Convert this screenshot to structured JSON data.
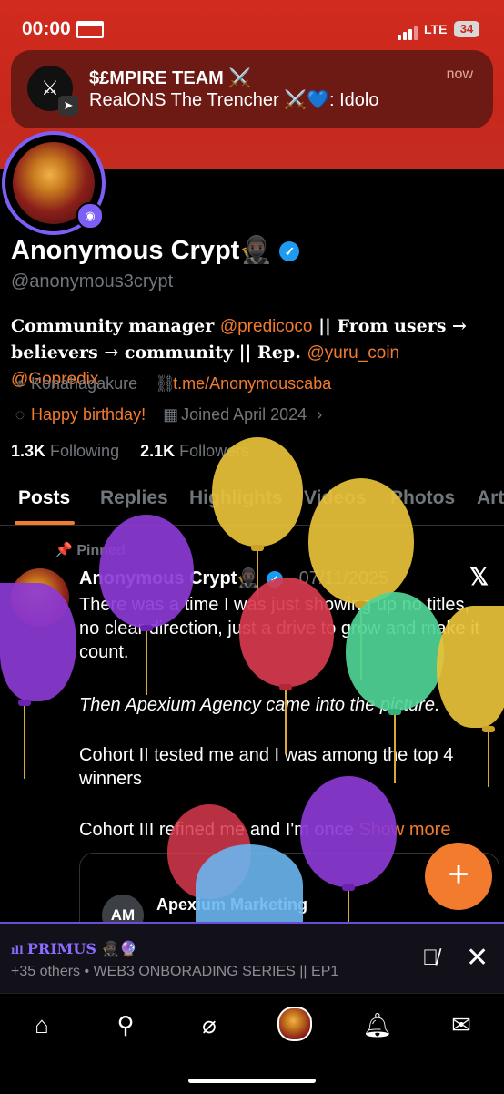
{
  "status": {
    "time": "00:00",
    "network": "LTE",
    "battery": "34"
  },
  "notification": {
    "title": "$£MPIRE TEAM ⚔️",
    "body": "RealONS The Trencher ⚔️💙: Idolo",
    "time": "now",
    "app_icon": "telegram-icon"
  },
  "profile": {
    "name": "Anonymous Crypt🥷🏿",
    "handle": "@anonymous3crypt",
    "bio_parts": {
      "p1": "Community manager ",
      "l1": "@predicoco",
      "p2": " || From users → believers → community || Rep. ",
      "l2": "@yuru_coin",
      "p3": " ",
      "l3": "@Gopredix"
    },
    "location": "Konahagakure",
    "link": "t.me/Anonymouscaba",
    "birthday": "Happy birthday!",
    "joined": "Joined April 2024",
    "following_count": "1.3K",
    "following_label": "Following",
    "followers_count": "2.1K",
    "followers_label": "Followers"
  },
  "tabs": [
    "Posts",
    "Replies",
    "Highlights",
    "Videos",
    "Photos",
    "Art"
  ],
  "post": {
    "pinned_label": "Pinned",
    "author": "Anonymous Crypt🥷🏿",
    "date": "· 07/11/2025",
    "p1": "There was a time I was just showing up no titles, no clear direction, just a drive to grow and make it count.",
    "p2": "Then Apexium Agency came into the picture.",
    "p3": "Cohort II tested me and I was among the top 4 winners",
    "p4": "Cohort III refined me and I'm once ",
    "show_more": "Show more",
    "quote_avatar": "AM",
    "quote_name": "Apexium Marketing"
  },
  "space": {
    "title": "PRIMUS 🥷🏿🔮",
    "subtitle": "+35 others • WEB3 ONBORADING SERIES || EP1"
  },
  "colors": {
    "accent": "#f27b2d",
    "verified": "#1d9bf0",
    "space": "#7d5ff5"
  }
}
